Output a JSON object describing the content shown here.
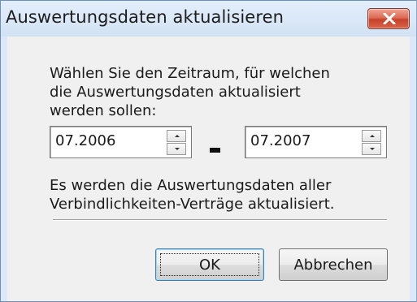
{
  "window": {
    "title": "Auswertungsdaten aktualisieren",
    "close_icon": "close-x-icon",
    "accent_close": "#c7422a"
  },
  "dialog": {
    "prompt_lines": [
      "Wählen Sie den Zeitraum, für welchen",
      "die Auswertungsdaten aktualisiert",
      "werden sollen:"
    ],
    "from_value": "07.2006",
    "range_separator": "-",
    "to_value": "07.2007",
    "info_lines": [
      "Es werden die Auswertungsdaten aller",
      "Verbindlichkeiten-Verträge aktualisiert."
    ],
    "ok_label": "OK",
    "cancel_label": "Abbrechen"
  }
}
